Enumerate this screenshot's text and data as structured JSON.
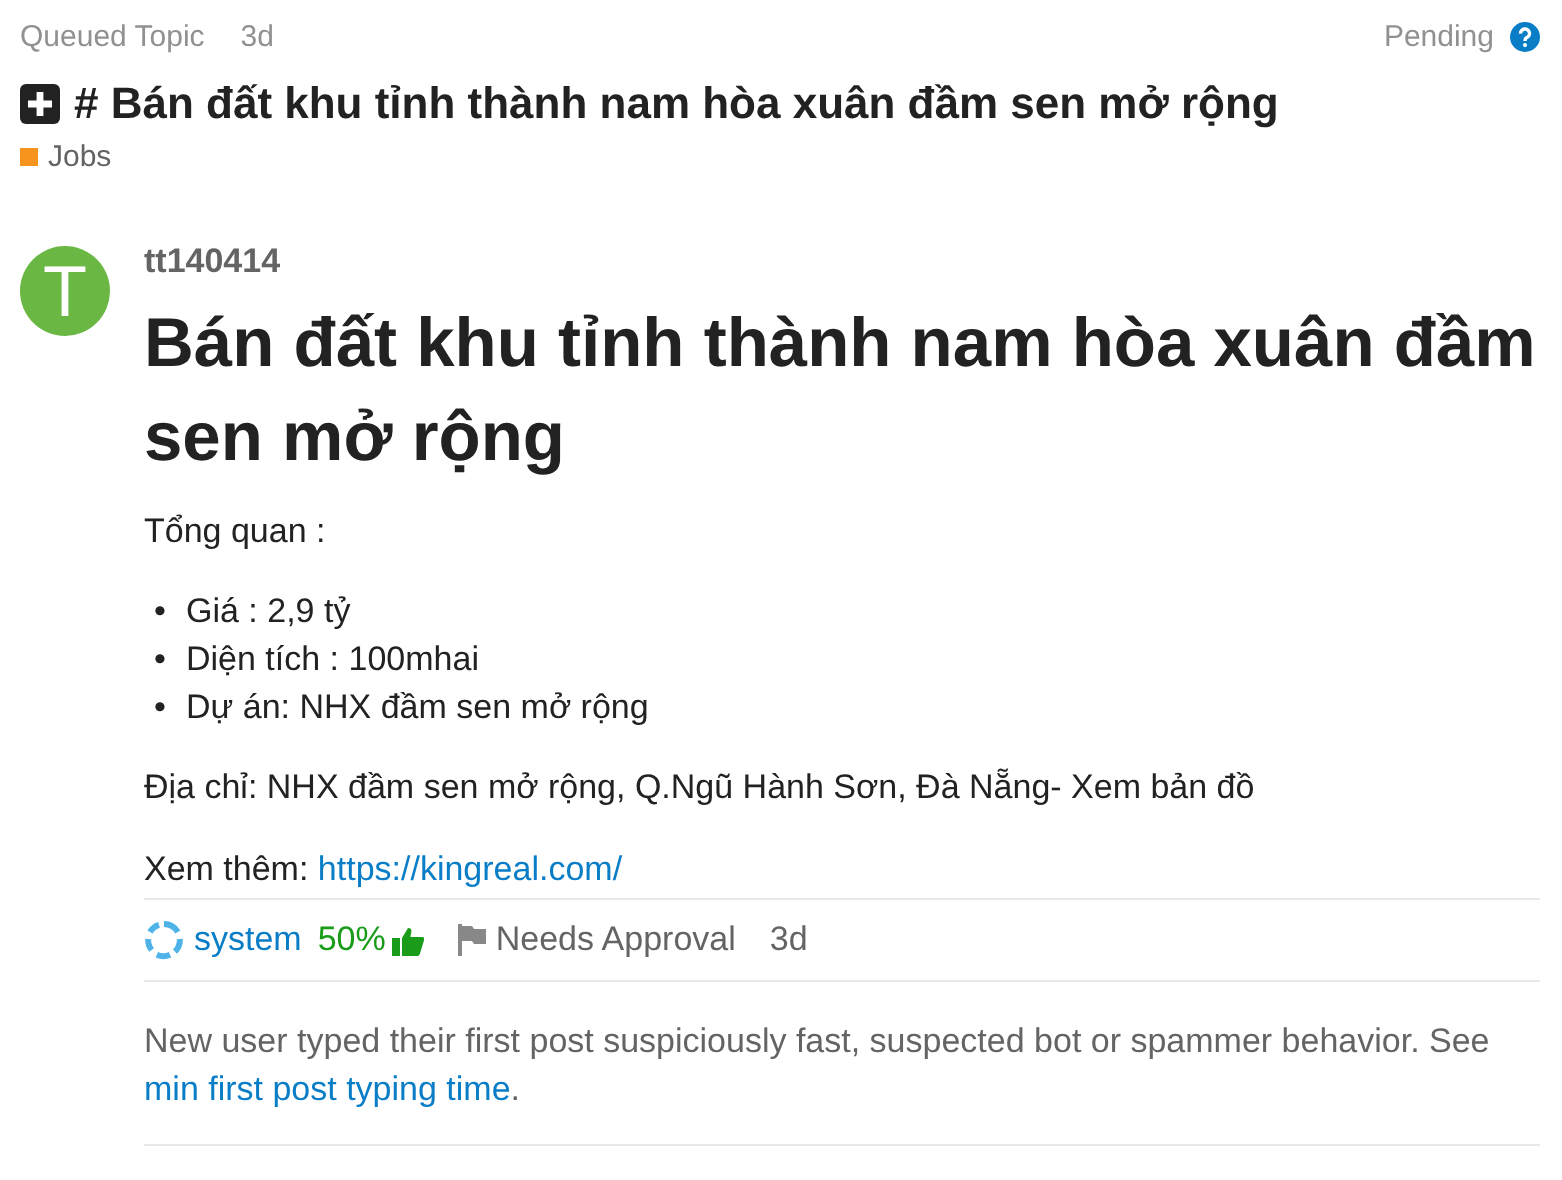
{
  "header": {
    "label": "Queued Topic",
    "age": "3d",
    "status": "Pending"
  },
  "topic": {
    "title": "# Bán đất khu tỉnh thành nam hòa xuân đầm sen mở rộng",
    "category": {
      "name": "Jobs",
      "color": "#f7941d"
    }
  },
  "post": {
    "avatar_letter": "T",
    "username": "tt140414",
    "heading": "Bán đất khu tỉnh thành nam hòa xuân đầm sen mở rộng",
    "intro": "Tổng quan :",
    "bullets": [
      {
        "marker": "•",
        "text": "Giá : 2,9 tỷ"
      },
      {
        "marker": "•",
        "text": "Diện tích : 100mhai"
      },
      {
        "marker": "•",
        "text": "Dự án: NHX đầm sen mở rộng"
      }
    ],
    "address": "Địa chỉ: NHX đầm sen mở rộng, Q.Ngũ Hành Sơn, Đà Nẵng- Xem bản đồ",
    "more_label": "Xem thêm: ",
    "more_link": "https://kingreal.com/"
  },
  "review": {
    "user": "system",
    "score": "50%",
    "reason": "Needs Approval",
    "age": "3d"
  },
  "explanation": {
    "text": "New user typed their first post suspiciously fast, suspected bot or spammer behavior. See ",
    "link": "min first post typing time",
    "end": "."
  }
}
